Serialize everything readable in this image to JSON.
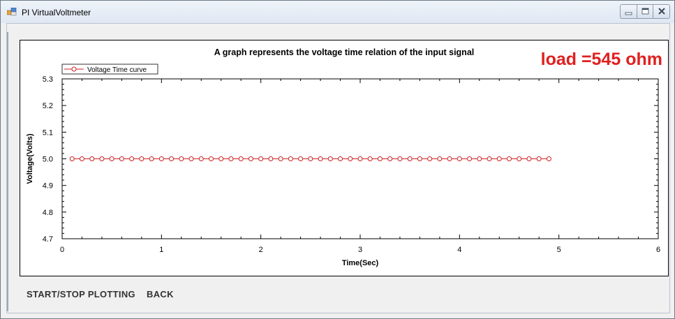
{
  "window": {
    "title": "PI VirtualVoltmeter"
  },
  "annotation": {
    "load_text": "load =545 ohm",
    "color": "#e02020"
  },
  "footer": {
    "start_stop_label": "START/STOP PLOTTING",
    "back_label": "BACK"
  },
  "chart_data": {
    "type": "line",
    "title": "A graph represents the voltage time relation of the input signal",
    "xlabel": "Time(Sec)",
    "ylabel": "Voltage(Volts)",
    "xlim": [
      0,
      6
    ],
    "ylim": [
      4.7,
      5.3
    ],
    "x_ticks": [
      "0",
      "1",
      "2",
      "3",
      "4",
      "5",
      "6"
    ],
    "y_ticks": [
      "4.7",
      "4.8",
      "4.9",
      "5.0",
      "5.1",
      "5.2",
      "5.3"
    ],
    "legend_position": "top-left",
    "grid": false,
    "series": [
      {
        "name": "Voltage Time curve",
        "color": "#cc2222",
        "marker": "circle",
        "x": [
          0.1,
          0.2,
          0.3,
          0.4,
          0.5,
          0.6,
          0.7,
          0.8,
          0.9,
          1.0,
          1.1,
          1.2,
          1.3,
          1.4,
          1.5,
          1.6,
          1.7,
          1.8,
          1.9,
          2.0,
          2.1,
          2.2,
          2.3,
          2.4,
          2.5,
          2.6,
          2.7,
          2.8,
          2.9,
          3.0,
          3.1,
          3.2,
          3.3,
          3.4,
          3.5,
          3.6,
          3.7,
          3.8,
          3.9,
          4.0,
          4.1,
          4.2,
          4.3,
          4.4,
          4.5,
          4.6,
          4.7,
          4.8,
          4.9
        ],
        "y": [
          5.0,
          5.0,
          5.0,
          5.0,
          5.0,
          5.0,
          5.0,
          5.0,
          5.0,
          5.0,
          5.0,
          5.0,
          5.0,
          5.0,
          5.0,
          5.0,
          5.0,
          5.0,
          5.0,
          5.0,
          5.0,
          5.0,
          5.0,
          5.0,
          5.0,
          5.0,
          5.0,
          5.0,
          5.0,
          5.0,
          5.0,
          5.0,
          5.0,
          5.0,
          5.0,
          5.0,
          5.0,
          5.0,
          5.0,
          5.0,
          5.0,
          5.0,
          5.0,
          5.0,
          5.0,
          5.0,
          5.0,
          5.0,
          5.0
        ]
      }
    ]
  }
}
